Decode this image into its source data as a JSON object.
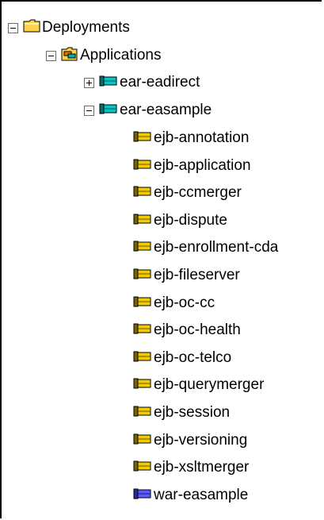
{
  "tree": {
    "root": {
      "label": "Deployments",
      "icon": "folder-icon",
      "toggle": "collapse"
    },
    "applications": {
      "label": "Applications",
      "icon": "applications-folder-icon",
      "toggle": "collapse"
    },
    "ear_eadirect": {
      "label": "ear-eadirect",
      "icon": "ear-module-icon",
      "toggle": "expand"
    },
    "ear_easample": {
      "label": "ear-easample",
      "icon": "ear-module-icon",
      "toggle": "collapse"
    },
    "modules": [
      {
        "label": "ejb-annotation",
        "icon": "ejb-module-icon"
      },
      {
        "label": "ejb-application",
        "icon": "ejb-module-icon"
      },
      {
        "label": "ejb-ccmerger",
        "icon": "ejb-module-icon"
      },
      {
        "label": "ejb-dispute",
        "icon": "ejb-module-icon"
      },
      {
        "label": "ejb-enrollment-cda",
        "icon": "ejb-module-icon"
      },
      {
        "label": "ejb-fileserver",
        "icon": "ejb-module-icon"
      },
      {
        "label": "ejb-oc-cc",
        "icon": "ejb-module-icon"
      },
      {
        "label": "ejb-oc-health",
        "icon": "ejb-module-icon"
      },
      {
        "label": "ejb-oc-telco",
        "icon": "ejb-module-icon"
      },
      {
        "label": "ejb-querymerger",
        "icon": "ejb-module-icon"
      },
      {
        "label": "ejb-session",
        "icon": "ejb-module-icon"
      },
      {
        "label": "ejb-versioning",
        "icon": "ejb-module-icon"
      },
      {
        "label": "ejb-xsltmerger",
        "icon": "ejb-module-icon"
      },
      {
        "label": "war-easample",
        "icon": "war-module-icon"
      }
    ]
  },
  "colors": {
    "ejb_bean": "#f2cc00",
    "ear_bean": "#00b3b3",
    "war_bean": "#5b5bff",
    "folder": "#ffd24a"
  }
}
